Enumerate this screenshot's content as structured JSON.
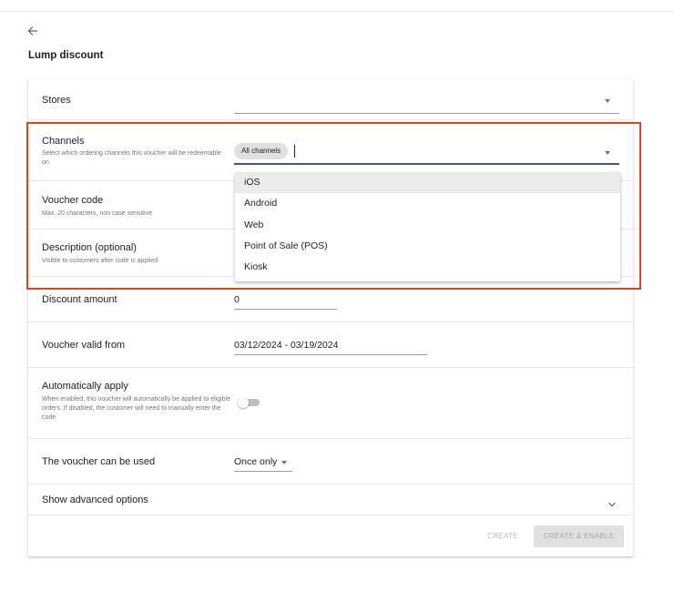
{
  "page": {
    "title": "Lump discount"
  },
  "icons": {
    "back": "arrow-left-icon",
    "dropdown": "caret-down-icon",
    "expand": "chevron-down-icon"
  },
  "colors": {
    "highlight": "#e0451c",
    "focus_underline": "#3f51b5",
    "active_option": "#ebebeb"
  },
  "form": {
    "stores": {
      "label": "Stores",
      "value": ""
    },
    "channels": {
      "label": "Channels",
      "hint": "Select which ordering channels this voucher will be redeemable on",
      "selected_chip": "All channels",
      "options": [
        "iOS",
        "Android",
        "Web",
        "Point of Sale (POS)",
        "Kiosk"
      ],
      "highlighted_option": "iOS"
    },
    "voucher_code": {
      "label": "Voucher code",
      "hint": "Max. 20 characters, non case sensitive"
    },
    "description": {
      "label": "Description (optional)",
      "hint": "Visible to customers after code is applied"
    },
    "discount_amount": {
      "label": "Discount amount",
      "value": "0"
    },
    "valid_from": {
      "label": "Voucher valid from",
      "value": "03/12/2024 - 03/19/2024"
    },
    "auto_apply": {
      "label": "Automatically apply",
      "hint": "When enabled, this voucher will automatically be applied to eligible orders. If disabled, the customer will need to manually enter the code",
      "enabled": false
    },
    "usage": {
      "label": "The voucher can be used",
      "value": "Once only"
    },
    "advanced": {
      "label": "Show advanced options"
    }
  },
  "actions": {
    "create": "CREATE",
    "create_enable": "CREATE & ENABLE"
  }
}
